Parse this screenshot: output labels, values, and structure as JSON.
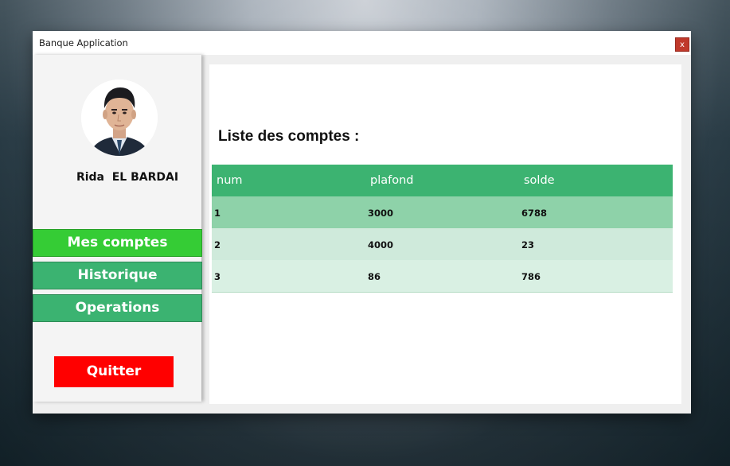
{
  "window": {
    "title": "Banque Application",
    "close_label": "x"
  },
  "sidebar": {
    "user_name": "Rida  EL BARDAI",
    "nav": [
      {
        "label": "Mes comptes",
        "active": true
      },
      {
        "label": "Historique",
        "active": false
      },
      {
        "label": "Operations",
        "active": false
      }
    ],
    "quit_label": "Quitter"
  },
  "main": {
    "title": "Liste des comptes :",
    "table": {
      "headers": [
        "num",
        "plafond",
        "solde"
      ],
      "rows": [
        [
          "1",
          "3000",
          "6788"
        ],
        [
          "2",
          "4000",
          "23"
        ],
        [
          "3",
          "86",
          "786"
        ]
      ]
    }
  },
  "colors": {
    "nav_active": "#35cc35",
    "nav_normal": "#3bb371",
    "quit": "#ff0000",
    "table_header": "#3cb371",
    "close": "#c0392b"
  }
}
